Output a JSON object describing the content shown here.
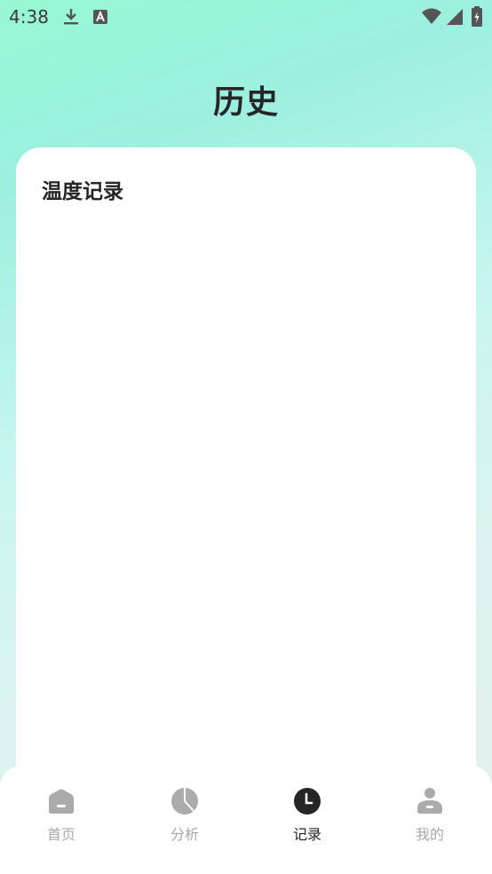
{
  "status_bar": {
    "time": "4:38",
    "icons": [
      "download-icon",
      "a-notification-icon",
      "wifi-icon",
      "signal-icon",
      "battery-charging-icon"
    ]
  },
  "page": {
    "title": "历史"
  },
  "card": {
    "title": "温度记录"
  },
  "tab_bar": {
    "tabs": [
      {
        "label": "首页",
        "icon": "home-icon",
        "active": false
      },
      {
        "label": "分析",
        "icon": "pie-chart-icon",
        "active": false
      },
      {
        "label": "记录",
        "icon": "clock-icon",
        "active": true
      },
      {
        "label": "我的",
        "icon": "profile-icon",
        "active": false
      }
    ]
  },
  "colors": {
    "active": "#262626",
    "inactive": "#a8a8a8",
    "gradient_top": "#98f8d4",
    "gradient_bottom": "#e6efef"
  }
}
